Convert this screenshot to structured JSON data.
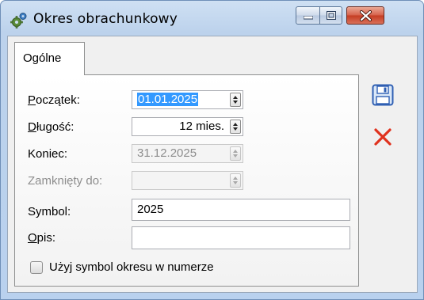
{
  "window": {
    "title": "Okres obrachunkowy"
  },
  "tabs": [
    {
      "label": "Ogólne"
    }
  ],
  "form": {
    "poczatek": {
      "label_first": "P",
      "label_rest": "oczątek:",
      "value": "01.01.2025"
    },
    "dlugosc": {
      "label_first": "D",
      "label_rest": "ługość:",
      "value": "12 mies."
    },
    "koniec": {
      "label": "Koniec:",
      "value": "31.12.2025"
    },
    "zamkniety": {
      "label": "Zamknięty do:",
      "value": ""
    },
    "symbol": {
      "label": "Symbol:",
      "value": "2025"
    },
    "opis": {
      "label_first": "O",
      "label_rest": "pis:",
      "value": ""
    },
    "checkbox": {
      "label": "Użyj symbol okresu w numerze",
      "checked": false
    }
  },
  "icons": {
    "app": "gears-icon",
    "save": "floppy-disk-icon",
    "cancel": "red-x-icon"
  },
  "colors": {
    "selection": "#3399ff",
    "close_button": "#c43c22",
    "cancel_x": "#e0321e",
    "save_blue": "#2f5fb3"
  }
}
